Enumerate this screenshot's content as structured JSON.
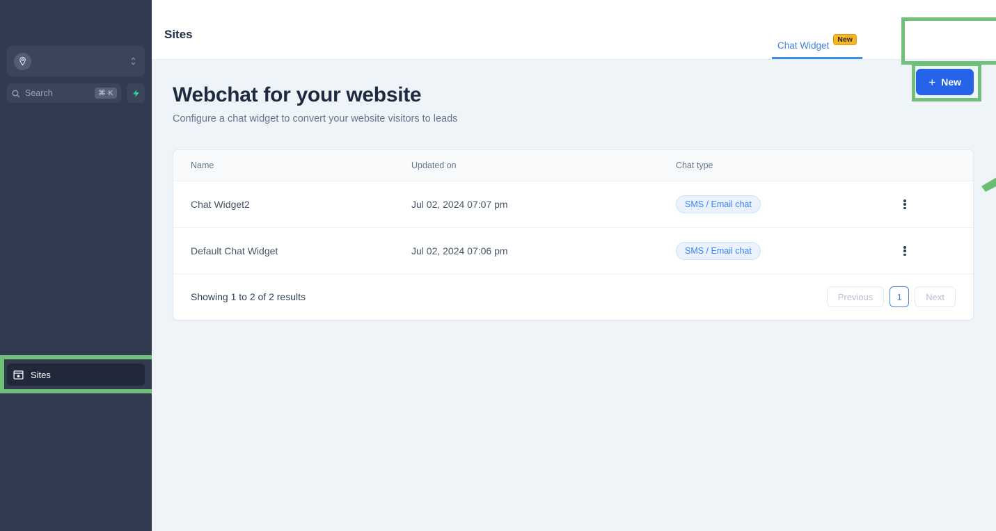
{
  "sidebar": {
    "workspace": {
      "name": "",
      "avatar_icon": "location-person-icon",
      "switcher_icon": "chevron-up-down-icon"
    },
    "search": {
      "placeholder": "Search",
      "icon": "search-icon",
      "shortcut": "⌘ K"
    },
    "quick_action": {
      "icon": "lightning-bolt-icon"
    },
    "items": [
      {
        "label": "Sites",
        "icon": "browser-window-icon",
        "active": true,
        "highlighted": true
      }
    ]
  },
  "topbar": {
    "title": "Sites",
    "tabs": [
      {
        "label": "Chat Widget",
        "badge": "New",
        "active": true,
        "highlighted": true
      }
    ]
  },
  "page": {
    "title": "Webchat for your website",
    "subtitle": "Configure a chat widget to convert your website visitors to leads",
    "new_button": {
      "label": "New",
      "icon": "plus-icon",
      "highlighted": true
    }
  },
  "table": {
    "columns": [
      "Name",
      "Updated on",
      "Chat type",
      ""
    ],
    "rows": [
      {
        "name": "Chat Widget2",
        "updated_on": "Jul 02, 2024 07:07 pm",
        "chat_type": "SMS / Email chat",
        "menu_icon": "vertical-dots-icon"
      },
      {
        "name": "Default Chat Widget",
        "updated_on": "Jul 02, 2024 07:06 pm",
        "chat_type": "SMS / Email chat",
        "menu_icon": "vertical-dots-icon"
      }
    ],
    "footer": {
      "results_text": "Showing 1 to 2 of 2 results",
      "previous_label": "Previous",
      "page_label": "1",
      "next_label": "Next"
    }
  },
  "annotations": {
    "highlight_color": "#70c07a",
    "arrow": {
      "icon": "green-arrow-icon",
      "points_to": "new-button"
    }
  },
  "colors": {
    "sidebar_bg": "#313a4e",
    "content_bg": "#eef4f8",
    "primary": "#2563e8",
    "tab_active": "#3f8fe0",
    "badge_new": "#f6b426",
    "pill_text": "#3b82f6"
  }
}
